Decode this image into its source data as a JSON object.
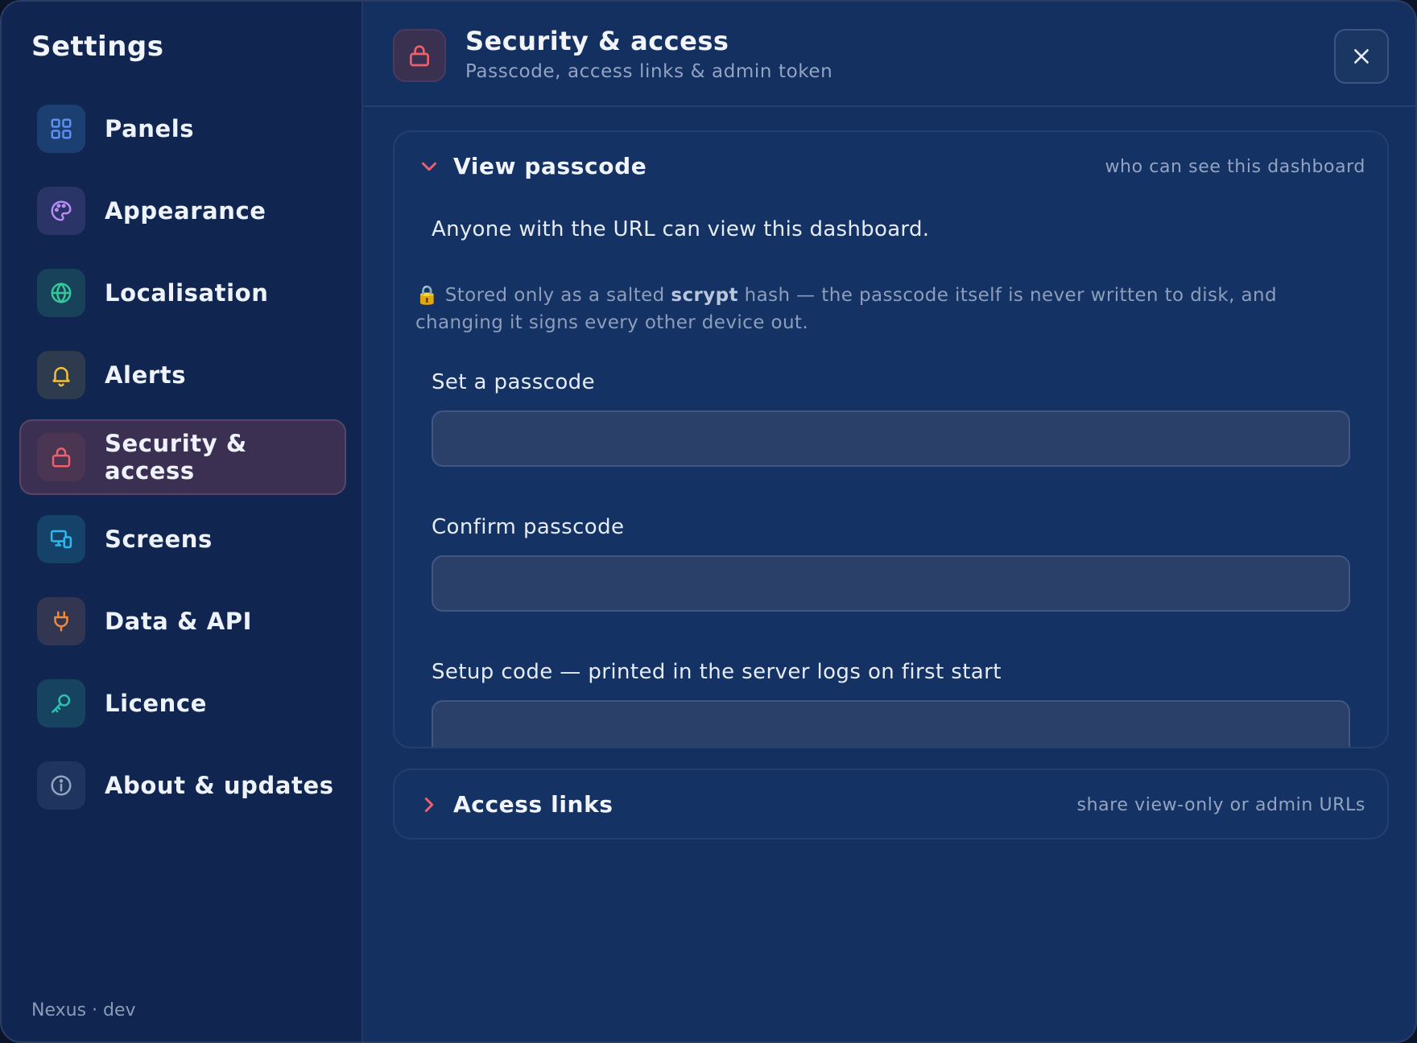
{
  "sidebar": {
    "title": "Settings",
    "items": [
      {
        "label": "Panels",
        "icon": "grid-icon",
        "color": "#5b8ff0",
        "bg": "#1c3f72"
      },
      {
        "label": "Appearance",
        "icon": "palette-icon",
        "color": "#b68cf2",
        "bg": "#2a3466"
      },
      {
        "label": "Localisation",
        "icon": "globe-icon",
        "color": "#34c79a",
        "bg": "#17425a"
      },
      {
        "label": "Alerts",
        "icon": "bell-icon",
        "color": "#f0c23a",
        "bg": "#2e3a4e"
      },
      {
        "label": "Security & access",
        "icon": "lock-icon",
        "color": "#f0606a",
        "bg": "#4a3553",
        "active": true
      },
      {
        "label": "Screens",
        "icon": "screens-icon",
        "color": "#2fb8ec",
        "bg": "#144268"
      },
      {
        "label": "Data & API",
        "icon": "plug-icon",
        "color": "#f08a3a",
        "bg": "#323650"
      },
      {
        "label": "Licence",
        "icon": "key-icon",
        "color": "#2fc0b0",
        "bg": "#164360"
      },
      {
        "label": "About & updates",
        "icon": "info-icon",
        "color": "#93a4c2",
        "bg": "#1f355d"
      }
    ],
    "footer": "Nexus · dev"
  },
  "header": {
    "icon": "lock-icon",
    "title": "Security & access",
    "subtitle": "Passcode, access links & admin token",
    "close_icon": "close-icon"
  },
  "sections": {
    "view_passcode": {
      "title": "View passcode",
      "hint": "who can see this dashboard",
      "expanded": true,
      "lead": "Anyone with the URL can view this dashboard.",
      "note_lock": "🔒",
      "note_pre": "Stored only as a salted",
      "note_bold": "scrypt",
      "note_post": "hash — the passcode itself is never written to disk, and changing it signs every other device out.",
      "fields": [
        {
          "label": "Set a passcode",
          "value": "",
          "placeholder": ""
        },
        {
          "label": "Confirm passcode",
          "value": "",
          "placeholder": ""
        },
        {
          "label": "Setup code — printed in the server logs on first start",
          "value": "",
          "placeholder": ""
        }
      ]
    },
    "access_links": {
      "title": "Access links",
      "hint": "share view-only or admin URLs",
      "expanded": false
    }
  },
  "colors": {
    "accent": "#f0606a",
    "background": "#133061",
    "sidebar": "#102650"
  }
}
